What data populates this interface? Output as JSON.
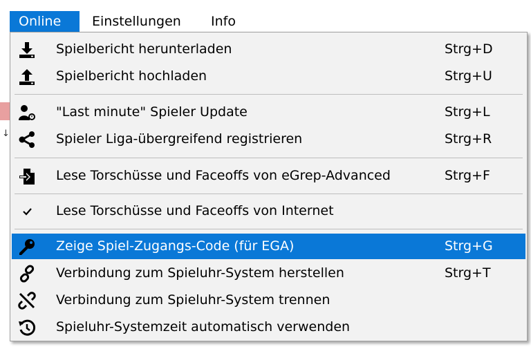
{
  "menubar": {
    "items": [
      {
        "label": "Online"
      },
      {
        "label": "Einstellungen"
      },
      {
        "label": "Info"
      }
    ]
  },
  "menu": {
    "items": [
      {
        "icon": "download-icon",
        "label": "Spielbericht herunterladen",
        "shortcut": "Strg+D"
      },
      {
        "icon": "upload-icon",
        "label": "Spielbericht hochladen",
        "shortcut": "Strg+U"
      },
      {
        "icon": "user-clock-icon",
        "label": "\"Last minute\" Spieler Update",
        "shortcut": "Strg+L"
      },
      {
        "icon": "share-icon",
        "label": "Spieler Liga-übergreifend registrieren",
        "shortcut": "Strg+R"
      },
      {
        "icon": "file-import-icon",
        "label": "Lese Torschüsse und Faceoffs von eGrep-Advanced",
        "shortcut": "Strg+F"
      },
      {
        "icon": "checkmark-icon",
        "label": "Lese Torschüsse und Faceoffs von Internet",
        "shortcut": ""
      },
      {
        "icon": "key-icon",
        "label": "Zeige Spiel-Zugangs-Code (für EGA)",
        "shortcut": "Strg+G",
        "selected": true
      },
      {
        "icon": "link-icon",
        "label": "Verbindung zum Spieluhr-System herstellen",
        "shortcut": "Strg+T"
      },
      {
        "icon": "unlink-icon",
        "label": "Verbindung zum Spieluhr-System trennen",
        "shortcut": ""
      },
      {
        "icon": "history-icon",
        "label": "Spieluhr-Systemzeit automatisch verwenden",
        "shortcut": ""
      }
    ]
  },
  "colors": {
    "accent": "#0a78d7",
    "menu_bg": "#f2f2f2"
  }
}
